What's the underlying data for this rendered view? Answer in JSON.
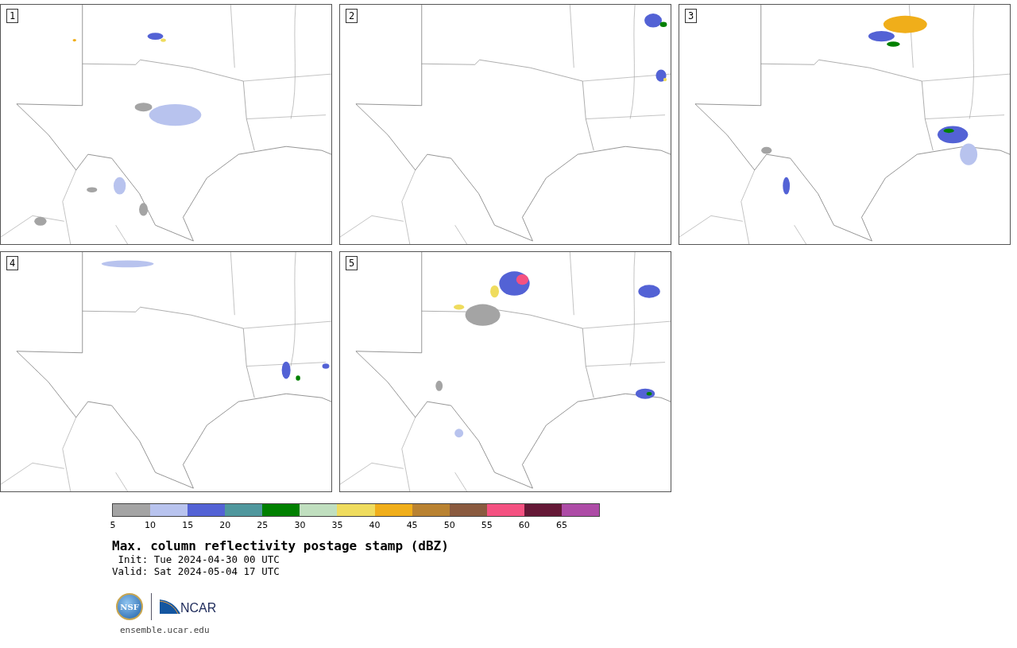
{
  "panels": [
    {
      "number": "1"
    },
    {
      "number": "2"
    },
    {
      "number": "3"
    },
    {
      "number": "4"
    },
    {
      "number": "5"
    }
  ],
  "colorbar": {
    "bins": [
      {
        "tick": "5",
        "color": "#a4a4a4"
      },
      {
        "tick": "10",
        "color": "#b8c3ee"
      },
      {
        "tick": "15",
        "color": "#5362d5"
      },
      {
        "tick": "20",
        "color": "#4f979d"
      },
      {
        "tick": "25",
        "color": "#008000"
      },
      {
        "tick": "30",
        "color": "#c0dfbf"
      },
      {
        "tick": "35",
        "color": "#efdc5e"
      },
      {
        "tick": "40",
        "color": "#f0ae1a"
      },
      {
        "tick": "45",
        "color": "#b98231"
      },
      {
        "tick": "50",
        "color": "#8a5a3f"
      },
      {
        "tick": "55",
        "color": "#f45181"
      },
      {
        "tick": "60",
        "color": "#641836"
      },
      {
        "tick": "65",
        "color": "#ad4ba6"
      }
    ]
  },
  "title": "Max. column reflectivity postage stamp (dBZ)",
  "init": " Init: Tue 2024-04-30 00 UTC",
  "valid": "Valid: Sat 2024-05-04 17 UTC",
  "logos": {
    "nsf": "NSF",
    "ncar": "NCAR"
  },
  "footer": "ensemble.ucar.edu"
}
